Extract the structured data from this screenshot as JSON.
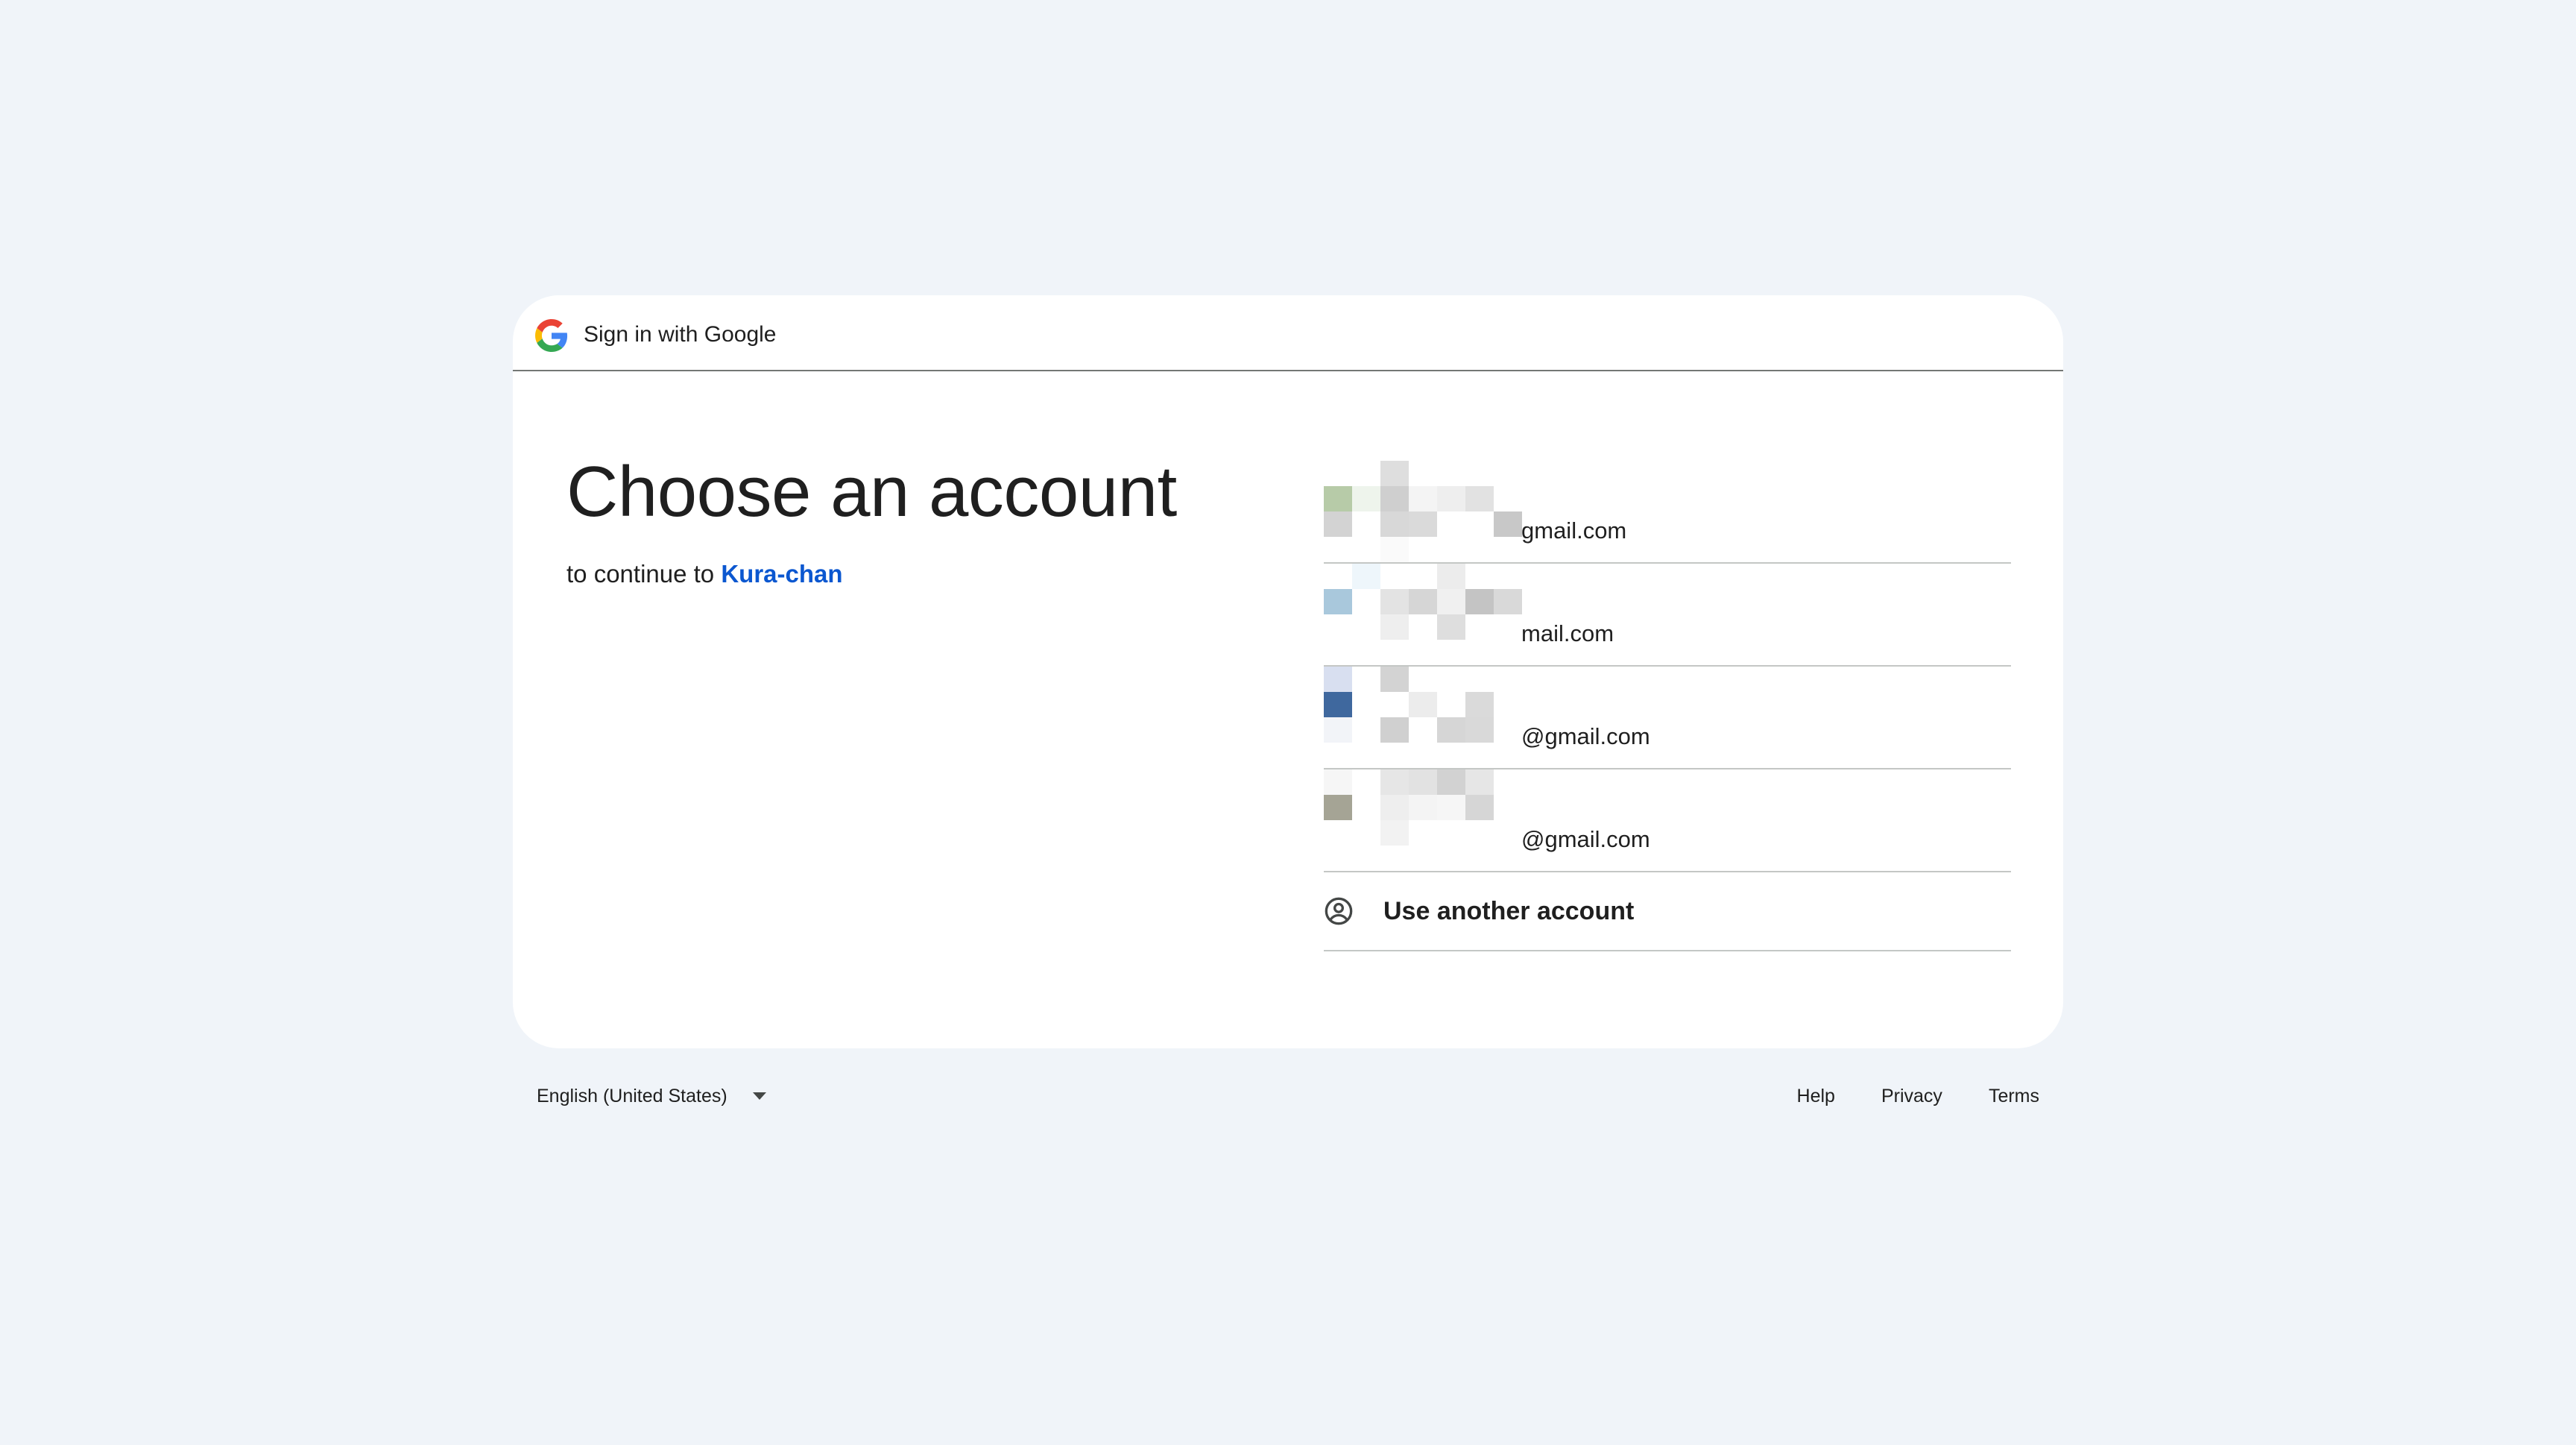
{
  "header": {
    "title": "Sign in with Google",
    "logo_icon": "google-g-icon"
  },
  "main": {
    "heading": "Choose an account",
    "subtitle_prefix": "to continue to ",
    "app_name": "Kura-chan"
  },
  "accounts": [
    {
      "email": "gmail.com",
      "avatar_pixels": [
        "#ffffff",
        "#ffffff",
        "#dedede",
        "#ffffff",
        "#ffffff",
        "#ffffff",
        "#ffffff",
        "#b7cba8",
        "#eef4ec",
        "#cfcfcf",
        "#f4f4f4",
        "#eeeeee",
        "#e2e2e2",
        "#ffffff",
        "#d3d3d3",
        "#ffffff",
        "#d8d8d8",
        "#dadada",
        "#ffffff",
        "#ffffff",
        "#c8c8c8",
        "#ffffff",
        "#ffffff",
        "#fafafa",
        "#ffffff",
        "#ffffff",
        "#ffffff",
        "#ffffff"
      ]
    },
    {
      "email": "mail.com",
      "avatar_pixels": [
        "#ffffff",
        "#eef6fb",
        "#ffffff",
        "#ffffff",
        "#ececec",
        "#ffffff",
        "#ffffff",
        "#a9c8dc",
        "#ffffff",
        "#e3e3e3",
        "#d6d6d6",
        "#f0f0f0",
        "#c4c4c4",
        "#d9d9d9",
        "#ffffff",
        "#ffffff",
        "#eeeeee",
        "#ffffff",
        "#dedede",
        "#ffffff",
        "#ffffff",
        "#ffffff",
        "#ffffff",
        "#ffffff",
        "#ffffff",
        "#ffffff",
        "#ffffff",
        "#ffffff"
      ]
    },
    {
      "email": "@gmail.com",
      "avatar_pixels": [
        "#d8dff0",
        "#ffffff",
        "#d3d3d3",
        "#ffffff",
        "#ffffff",
        "#ffffff",
        "#ffffff",
        "#3f689e",
        "#ffffff",
        "#ffffff",
        "#ececec",
        "#ffffff",
        "#dadada",
        "#ffffff",
        "#f2f4f8",
        "#ffffff",
        "#d0d0d0",
        "#ffffff",
        "#d6d6d6",
        "#d9d9d9",
        "#ffffff",
        "#ffffff",
        "#ffffff",
        "#ffffff",
        "#ffffff",
        "#ffffff",
        "#ffffff",
        "#ffffff"
      ]
    },
    {
      "email": "@gmail.com",
      "avatar_pixels": [
        "#f6f6f6",
        "#ffffff",
        "#e6e6e6",
        "#e2e2e2",
        "#d2d2d2",
        "#e6e6e6",
        "#ffffff",
        "#a5a495",
        "#ffffff",
        "#eeeeee",
        "#f4f4f4",
        "#f6f6f6",
        "#d6d6d6",
        "#ffffff",
        "#ffffff",
        "#ffffff",
        "#f2f2f2",
        "#ffffff",
        "#ffffff",
        "#ffffff",
        "#ffffff",
        "#ffffff",
        "#ffffff",
        "#ffffff",
        "#ffffff",
        "#ffffff",
        "#ffffff",
        "#ffffff"
      ]
    }
  ],
  "use_another": {
    "label": "Use another account",
    "icon": "account-circle-icon"
  },
  "footer": {
    "language": "English (United States)",
    "links": [
      "Help",
      "Privacy",
      "Terms"
    ]
  },
  "colors": {
    "background": "#f0f4f9",
    "card": "#ffffff",
    "link": "#0b57d0",
    "divider": "#c4c7c5"
  }
}
